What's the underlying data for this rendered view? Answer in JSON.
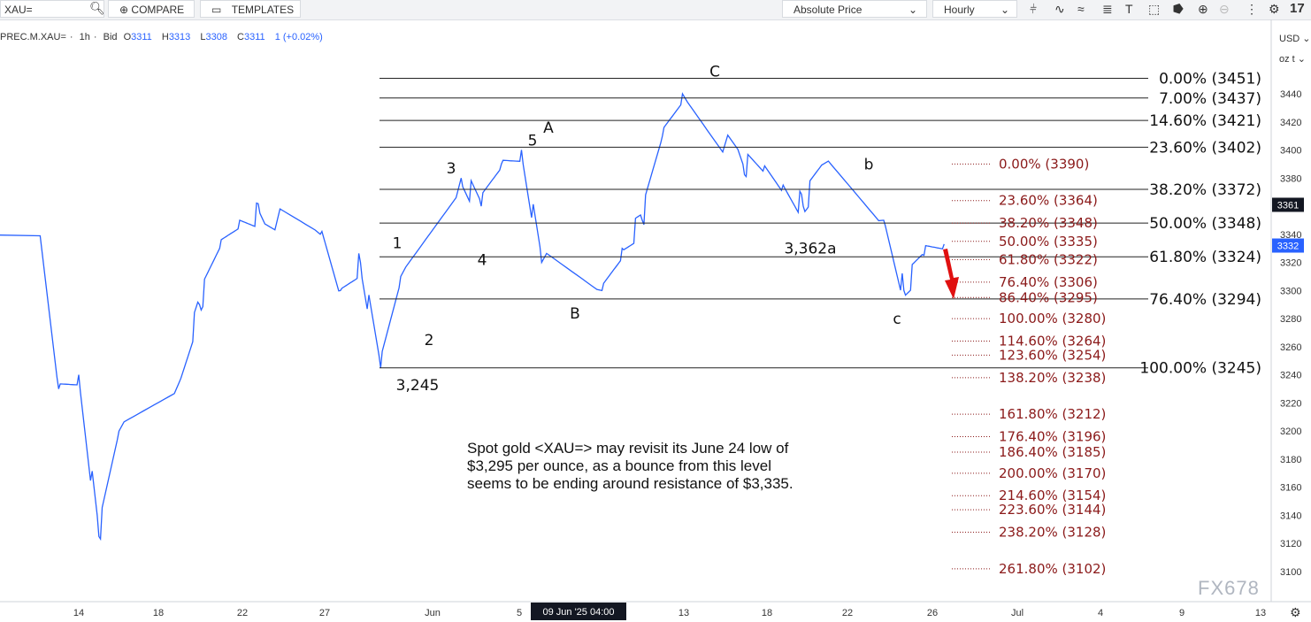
{
  "toolbar": {
    "symbol_value": "XAU=",
    "compare_label": "COMPARE",
    "templates_label": "TEMPLATES",
    "price_mode": "Absolute Price",
    "interval": "Hourly",
    "tool_icons": [
      "candles-icon",
      "indicator-icon",
      "wave-icon",
      "lines-icon",
      "text-tool-icon",
      "shape-icon",
      "pattern-icon",
      "zoom-in-icon",
      "zoom-out-icon",
      "more-icon",
      "settings-icon",
      "tv-logo-icon"
    ]
  },
  "header": {
    "instrument": "PREC.M.XAU=",
    "interval": "1h",
    "side": "Bid",
    "o": "3311",
    "h": "3313",
    "l": "3308",
    "c": "3311",
    "change": "1 (+0.02%)"
  },
  "axis_controls": {
    "currency": "USD",
    "unit": "oz t"
  },
  "last_price_tag": "3332",
  "crosshair_price_tag": "3361",
  "crosshair_time_tag": "09 Jun '25  04:00",
  "watermark": "FX678",
  "note": "Spot gold <XAU=> may revisit its June 24 low of\n$3,295 per ounce, as a bounce from this level\nseems to be ending around resistance of $3,335.",
  "colors": {
    "series": "#2962ff",
    "fib_right": "#8b1a1a",
    "arrow": "#e01010",
    "levels": "#111111"
  },
  "chart_data": {
    "type": "line",
    "title": "",
    "xlabel": "",
    "ylabel": "",
    "ylim": [
      3090,
      3460
    ],
    "y_ticks": [
      3100,
      3120,
      3140,
      3160,
      3180,
      3200,
      3220,
      3240,
      3260,
      3280,
      3300,
      3320,
      3340,
      3360,
      3380,
      3400,
      3420,
      3440
    ],
    "x_ticks": [
      "14",
      "18",
      "22",
      "27",
      "Jun",
      "5",
      "9",
      "13",
      "18",
      "22",
      "26",
      "Jul",
      "4",
      "9",
      "13"
    ],
    "series": [
      {
        "name": "",
        "x": [
          "May 12",
          "May 13",
          "May 14",
          "May 15",
          "May 16",
          "May 19",
          "May 20",
          "May 21",
          "May 22",
          "May 23",
          "May 26",
          "May 27",
          "May 28",
          "May 29",
          "May 30",
          "Jun 2",
          "Jun 3",
          "Jun 4",
          "Jun 5",
          "Jun 6",
          "Jun 9",
          "Jun 10",
          "Jun 11",
          "Jun 12",
          "Jun 13",
          "Jun 16",
          "Jun 17",
          "Jun 18",
          "Jun 19",
          "Jun 20",
          "Jun 23",
          "Jun 24",
          "Jun 25",
          "Jun 26"
        ],
        "values": [
          3340,
          3230,
          3240,
          3125,
          3200,
          3235,
          3290,
          3330,
          3350,
          3355,
          3340,
          3300,
          3320,
          3245,
          3310,
          3380,
          3360,
          3390,
          3400,
          3320,
          3300,
          3330,
          3350,
          3410,
          3440,
          3390,
          3385,
          3375,
          3360,
          3390,
          3350,
          3300,
          3325,
          3333
        ]
      }
    ],
    "wave_labels": [
      {
        "text": "1",
        "x": "May 30",
        "y": 3334
      },
      {
        "text": "2",
        "x": "May 31",
        "y": 3265
      },
      {
        "text": "3",
        "x": "Jun 2",
        "y": 3387
      },
      {
        "text": "4",
        "x": "Jun 3",
        "y": 3322
      },
      {
        "text": "5",
        "x": "Jun 5",
        "y": 3407
      },
      {
        "text": "A",
        "x": "Jun 5",
        "y": 3416
      },
      {
        "text": "B",
        "x": "Jun 9",
        "y": 3284
      },
      {
        "text": "C",
        "x": "Jun 13",
        "y": 3456
      },
      {
        "text": "b",
        "x": "Jun 23",
        "y": 3390
      },
      {
        "text": "c",
        "x": "Jun 24",
        "y": 3280
      },
      {
        "text": "3,362a",
        "x": "Jun 20",
        "y": 3330
      },
      {
        "text": "3,245",
        "x": "May 30",
        "y": 3233
      }
    ],
    "fib_left": [
      {
        "label": "0.00% (3451)",
        "value": 3451
      },
      {
        "label": "7.00% (3437)",
        "value": 3437
      },
      {
        "label": "14.60% (3421)",
        "value": 3421
      },
      {
        "label": "23.60% (3402)",
        "value": 3402
      },
      {
        "label": "38.20% (3372)",
        "value": 3372
      },
      {
        "label": "50.00% (3348)",
        "value": 3348
      },
      {
        "label": "61.80% (3324)",
        "value": 3324
      },
      {
        "label": "76.40% (3294)",
        "value": 3294
      },
      {
        "label": "100.00% (3245)",
        "value": 3245
      }
    ],
    "fib_right": [
      {
        "label": "0.00% (3390)",
        "value": 3390
      },
      {
        "label": "23.60% (3364)",
        "value": 3364
      },
      {
        "label": "38.20% (3348)",
        "value": 3348
      },
      {
        "label": "50.00% (3335)",
        "value": 3335
      },
      {
        "label": "61.80% (3322)",
        "value": 3322
      },
      {
        "label": "76.40% (3306)",
        "value": 3306
      },
      {
        "label": "86.40% (3295)",
        "value": 3295
      },
      {
        "label": "100.00% (3280)",
        "value": 3280
      },
      {
        "label": "114.60% (3264)",
        "value": 3264
      },
      {
        "label": "123.60% (3254)",
        "value": 3254
      },
      {
        "label": "138.20% (3238)",
        "value": 3238
      },
      {
        "label": "161.80% (3212)",
        "value": 3212
      },
      {
        "label": "176.40% (3196)",
        "value": 3196
      },
      {
        "label": "186.40% (3185)",
        "value": 3185
      },
      {
        "label": "200.00% (3170)",
        "value": 3170
      },
      {
        "label": "214.60% (3154)",
        "value": 3154
      },
      {
        "label": "223.60% (3144)",
        "value": 3144
      },
      {
        "label": "238.20% (3128)",
        "value": 3128
      },
      {
        "label": "261.80% (3102)",
        "value": 3102
      }
    ]
  }
}
